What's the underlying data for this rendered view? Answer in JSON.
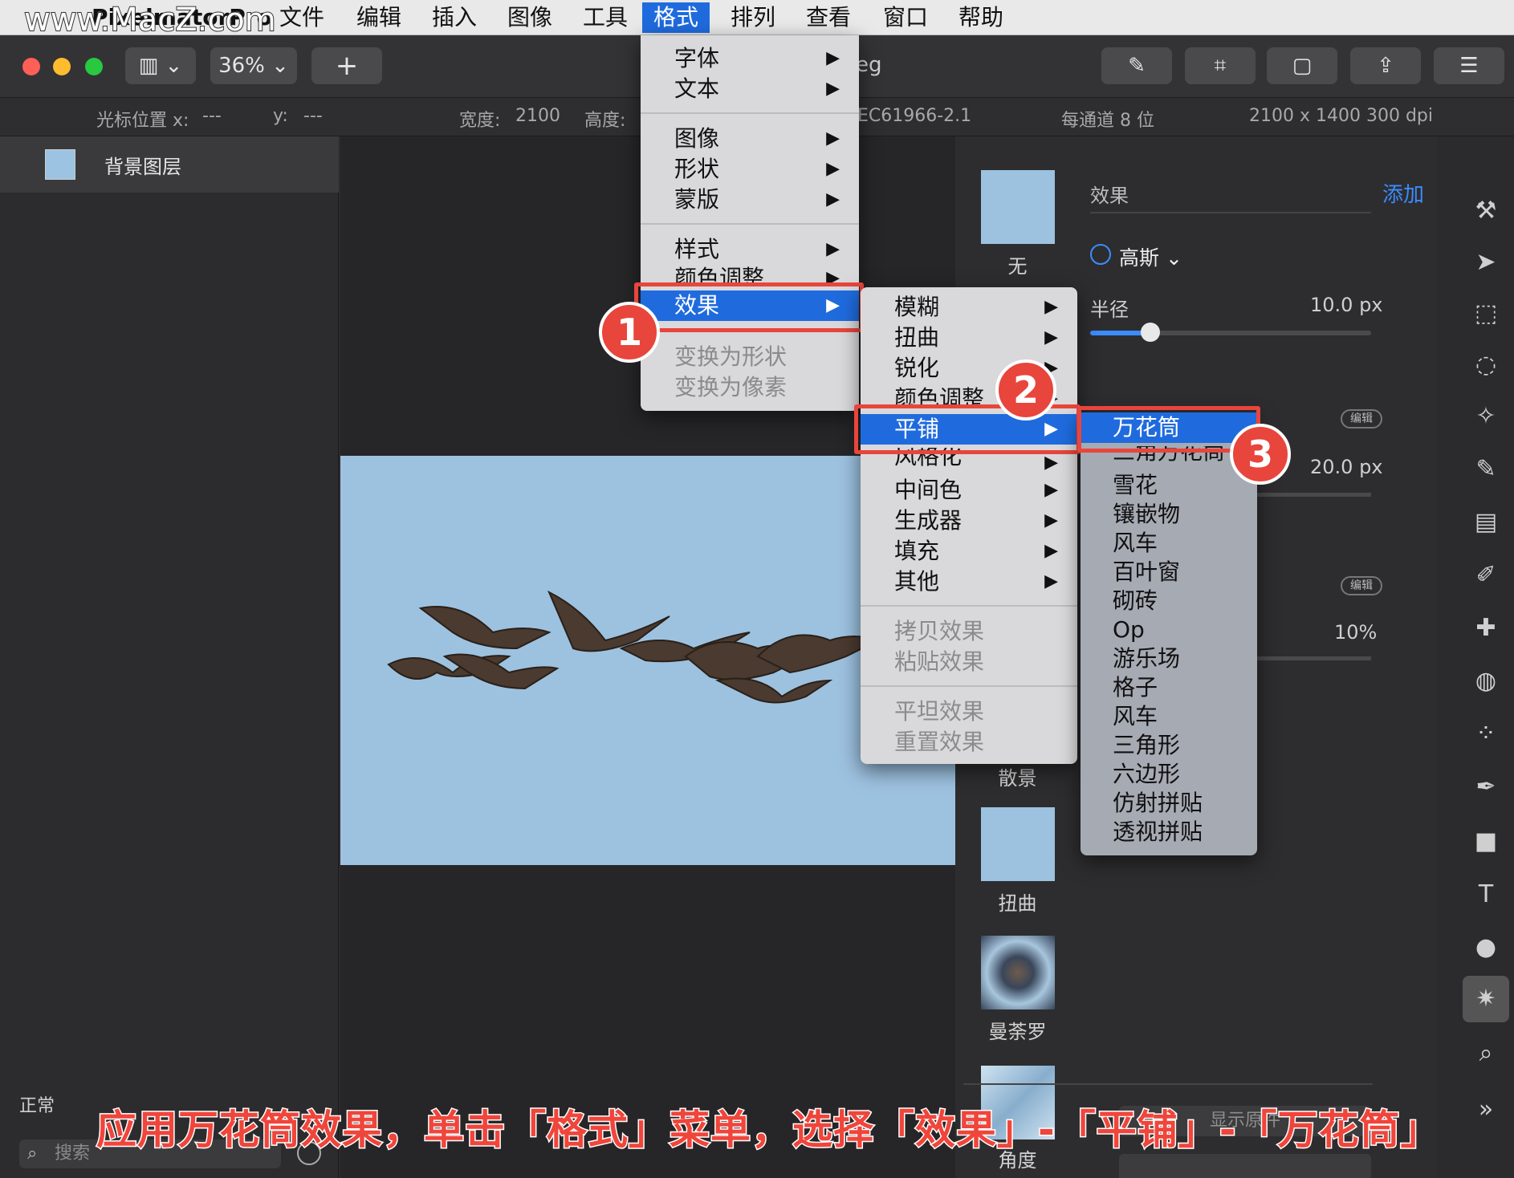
{
  "app": {
    "name": "PixelmatorPro",
    "watermark": "www.MacZ.com"
  },
  "menubar": {
    "items": [
      "文件",
      "编辑",
      "插入",
      "图像",
      "工具",
      "格式",
      "排列",
      "查看",
      "窗口",
      "帮助"
    ],
    "active": "格式"
  },
  "toolbar": {
    "zoom": "36%",
    "add": "+",
    "doc_title_fragment": "eg"
  },
  "infobar": {
    "cursor_x_label": "光标位置 x:",
    "cursor_x": "---",
    "cursor_y_label": "y:",
    "cursor_y": "---",
    "width_label": "宽度:",
    "width": "2100",
    "height_label": "高度:",
    "profile_fragment": "EC61966-2.1",
    "depth": "每通道 8 位",
    "size": "2100 x 1400 300 dpi"
  },
  "layers": {
    "items": [
      {
        "name": "背景图层"
      }
    ],
    "blend_mode": "正常",
    "search_placeholder": "搜索"
  },
  "browser": {
    "items": [
      {
        "label": "无"
      },
      {
        "label": "散景"
      },
      {
        "label": "扭曲"
      },
      {
        "label": "曼荼罗"
      },
      {
        "label": "角度"
      }
    ]
  },
  "inspector": {
    "title": "效果",
    "add": "添加",
    "effect_name": "高斯",
    "radius_label": "半径",
    "radius_value": "10.0 px",
    "radius_fraction": 0.1,
    "edit": "编辑",
    "value2": "20.0 px",
    "value3": "10%",
    "show_original": "显示原件"
  },
  "format_menu": {
    "items": [
      "字体",
      "文本",
      "图像",
      "形状",
      "蒙版",
      "样式",
      "颜色调整",
      "效果",
      "变换为形状",
      "变换为像素"
    ]
  },
  "effects_menu": {
    "items": [
      "模糊",
      "扭曲",
      "锐化",
      "颜色调整",
      "平铺",
      "风格化",
      "中间色",
      "生成器",
      "填充",
      "其他",
      "拷贝效果",
      "粘贴效果",
      "平坦效果",
      "重置效果"
    ]
  },
  "tile_menu": {
    "items": [
      "万花筒",
      "三角万花筒",
      "雪花",
      "镶嵌物",
      "风车",
      "百叶窗",
      "砌砖",
      "Op",
      "游乐场",
      "格子",
      "风车",
      "三角形",
      "六边形",
      "仿射拼贴",
      "透视拼贴"
    ]
  },
  "annotations": {
    "badges": [
      "1",
      "2",
      "3"
    ],
    "caption": "应用万花筒效果，单击「格式」菜单，选择「效果」-「平铺」-「万花筒」"
  },
  "colors": {
    "accent": "#1f6bde",
    "annotation_red": "#e8453c"
  }
}
